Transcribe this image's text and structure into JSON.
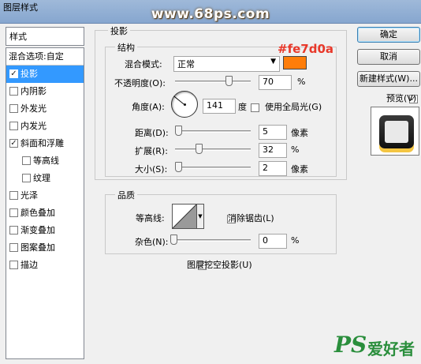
{
  "window": {
    "title": "图层样式",
    "watermark": "www.68ps.com",
    "annotation": "#fe7d0a"
  },
  "sidebar": {
    "header": "样式",
    "blend_options": "混合选项:自定",
    "items": [
      {
        "label": "投影",
        "checked": true,
        "selected": true
      },
      {
        "label": "内阴影",
        "checked": false
      },
      {
        "label": "外发光",
        "checked": false
      },
      {
        "label": "内发光",
        "checked": false
      },
      {
        "label": "斜面和浮雕",
        "checked": true
      },
      {
        "label": "等高线",
        "checked": false,
        "indent": true
      },
      {
        "label": "纹理",
        "checked": false,
        "indent": true
      },
      {
        "label": "光泽",
        "checked": false
      },
      {
        "label": "颜色叠加",
        "checked": false
      },
      {
        "label": "渐变叠加",
        "checked": false
      },
      {
        "label": "图案叠加",
        "checked": false
      },
      {
        "label": "描边",
        "checked": false
      }
    ]
  },
  "drop_shadow": {
    "group_title": "投影",
    "structure_title": "结构",
    "blend_mode_label": "混合模式:",
    "blend_mode_value": "正常",
    "shadow_color": "#fe7d0a",
    "opacity_label": "不透明度(O):",
    "opacity_value": "70",
    "opacity_unit": "%",
    "angle_label": "角度(A):",
    "angle_value": "141",
    "angle_unit": "度",
    "global_light_label": "使用全局光(G)",
    "distance_label": "距离(D):",
    "distance_value": "5",
    "distance_unit": "像素",
    "spread_label": "扩展(R):",
    "spread_value": "32",
    "spread_unit": "%",
    "size_label": "大小(S):",
    "size_value": "2",
    "size_unit": "像素",
    "quality_title": "品质",
    "contour_label": "等高线:",
    "anti_alias_label": "消除锯齿(L)",
    "noise_label": "杂色(N):",
    "noise_value": "0",
    "noise_unit": "%",
    "knockout_label": "图层挖空投影(U)",
    "knockout_checked": true
  },
  "buttons": {
    "ok": "确定",
    "cancel": "取消",
    "new_style": "新建样式(W)...",
    "preview": "预览(V)",
    "preview_checked": true
  },
  "branding": {
    "ps": "PS",
    "chinese": "爱好者"
  },
  "colors": {
    "selection": "#3399ff",
    "shadow_swatch": "#fe7d0a",
    "annotation": "#e8382a"
  }
}
